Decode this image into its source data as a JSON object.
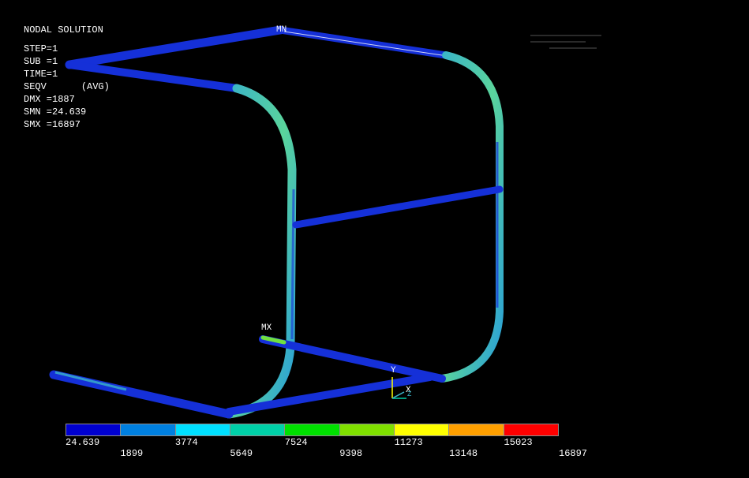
{
  "window": {
    "title": ""
  },
  "info": {
    "title": "NODAL SOLUTION",
    "step": "STEP=1",
    "sub": "SUB =1",
    "time": "TIME=1",
    "seqv": "SEQV",
    "avg": "(AVG)",
    "dmx": "DMX =1887",
    "smn": "SMN =24.639",
    "smx": "SMX =16897"
  },
  "markers": {
    "mn": "MN",
    "mx": "MX"
  },
  "triad": {
    "y": "Y",
    "x": "X",
    "z": "Z"
  },
  "legend": {
    "colors": [
      "#0000d0",
      "#0080e0",
      "#00e0ff",
      "#00d0a8",
      "#00e000",
      "#80e000",
      "#ffff00",
      "#ffa000",
      "#ff0000"
    ],
    "upper_labels": [
      "24.639",
      "3774",
      "7524",
      "11273",
      "15023"
    ],
    "lower_labels": [
      "1899",
      "5649",
      "9398",
      "13148",
      "16897"
    ]
  },
  "colors": {
    "background": "#000000",
    "low_stress": "#1530d8",
    "mid_stress": "#3fc8a0",
    "high_stress": "#70e040"
  },
  "icons": {
    "triad": "coordinate-triad-icon"
  }
}
